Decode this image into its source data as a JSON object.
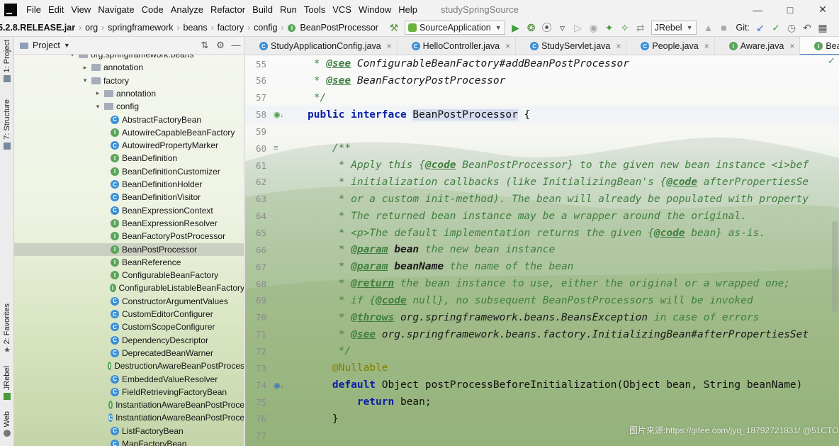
{
  "menu": {
    "items": [
      "File",
      "Edit",
      "View",
      "Navigate",
      "Code",
      "Analyze",
      "Refactor",
      "Build",
      "Run",
      "Tools",
      "VCS",
      "Window",
      "Help"
    ],
    "window_title": "studySpringSource"
  },
  "navbar": {
    "breadcrumbs": [
      "5.2.8.RELEASE.jar",
      "org",
      "springframework",
      "beans",
      "factory",
      "config",
      "BeanPostProcessor"
    ],
    "run_config": "SourceApplication",
    "jrebel": "JRebel",
    "git_label": "Git:"
  },
  "left_stripe": {
    "tabs": [
      "1: Project",
      "7: Structure",
      "2: Favorites",
      "JRebel",
      "Web"
    ]
  },
  "project": {
    "title": "Project",
    "tree": [
      {
        "label": "org.springframework.beans",
        "icon": "package",
        "indent": 0,
        "arrow": "down"
      },
      {
        "label": "annotation",
        "icon": "package",
        "indent": 1,
        "arrow": "right"
      },
      {
        "label": "factory",
        "icon": "package",
        "indent": 1,
        "arrow": "down"
      },
      {
        "label": "annotation",
        "icon": "package",
        "indent": 2,
        "arrow": "right"
      },
      {
        "label": "config",
        "icon": "package",
        "indent": 2,
        "arrow": "down"
      },
      {
        "label": "AbstractFactoryBean",
        "icon": "class",
        "indent": 3
      },
      {
        "label": "AutowireCapableBeanFactory",
        "icon": "interface",
        "indent": 3
      },
      {
        "label": "AutowiredPropertyMarker",
        "icon": "class",
        "indent": 3
      },
      {
        "label": "BeanDefinition",
        "icon": "interface",
        "indent": 3
      },
      {
        "label": "BeanDefinitionCustomizer",
        "icon": "interface",
        "indent": 3
      },
      {
        "label": "BeanDefinitionHolder",
        "icon": "class",
        "indent": 3
      },
      {
        "label": "BeanDefinitionVisitor",
        "icon": "class",
        "indent": 3
      },
      {
        "label": "BeanExpressionContext",
        "icon": "class",
        "indent": 3
      },
      {
        "label": "BeanExpressionResolver",
        "icon": "interface",
        "indent": 3
      },
      {
        "label": "BeanFactoryPostProcessor",
        "icon": "interface",
        "indent": 3
      },
      {
        "label": "BeanPostProcessor",
        "icon": "interface",
        "indent": 3,
        "selected": true
      },
      {
        "label": "BeanReference",
        "icon": "interface",
        "indent": 3
      },
      {
        "label": "ConfigurableBeanFactory",
        "icon": "interface",
        "indent": 3
      },
      {
        "label": "ConfigurableListableBeanFactory",
        "icon": "interface",
        "indent": 3
      },
      {
        "label": "ConstructorArgumentValues",
        "icon": "class",
        "indent": 3
      },
      {
        "label": "CustomEditorConfigurer",
        "icon": "class",
        "indent": 3
      },
      {
        "label": "CustomScopeConfigurer",
        "icon": "class",
        "indent": 3
      },
      {
        "label": "DependencyDescriptor",
        "icon": "class",
        "indent": 3
      },
      {
        "label": "DeprecatedBeanWarner",
        "icon": "class",
        "indent": 3
      },
      {
        "label": "DestructionAwareBeanPostProces",
        "icon": "interface",
        "indent": 3
      },
      {
        "label": "EmbeddedValueResolver",
        "icon": "class",
        "indent": 3
      },
      {
        "label": "FieldRetrievingFactoryBean",
        "icon": "class",
        "indent": 3
      },
      {
        "label": "InstantiationAwareBeanPostProce",
        "icon": "interface",
        "indent": 3
      },
      {
        "label": "InstantiationAwareBeanPostProce",
        "icon": "class",
        "indent": 3
      },
      {
        "label": "ListFactoryBean",
        "icon": "class",
        "indent": 3
      },
      {
        "label": "MapFactoryBean",
        "icon": "class",
        "indent": 3
      }
    ]
  },
  "tabs": [
    {
      "label": "StudyApplicationConfig.java",
      "icon": "class"
    },
    {
      "label": "HelloController.java",
      "icon": "class"
    },
    {
      "label": "StudyServlet.java",
      "icon": "class"
    },
    {
      "label": "People.java",
      "icon": "class"
    },
    {
      "label": "Aware.java",
      "icon": "interface"
    },
    {
      "label": "BeanPostProcessor.java",
      "icon": "interface",
      "active": true
    }
  ],
  "editor": {
    "lines": [
      {
        "no": "55",
        "html": "<span class=\"doc\"> * <span class=\"tag\">@see</span> </span><span style=\"font-style:italic;color:#1a1a1a\">ConfigurableBeanFactory#addBeanPostProcessor</span>"
      },
      {
        "no": "56",
        "html": "<span class=\"doc\"> * <span class=\"tag\">@see</span> </span><span style=\"font-style:italic;color:#1a1a1a\">BeanFactoryPostProcessor</span>"
      },
      {
        "no": "57",
        "html": "<span class=\"doc\"> */</span>"
      },
      {
        "no": "58",
        "gutter": "impl",
        "highlight": true,
        "html": "<span class=\"kw\">public interface</span> <span class=\"ident-hl\">BeanPostProcessor</span> {"
      },
      {
        "no": "59",
        "html": ""
      },
      {
        "no": "60",
        "gutter": "doc",
        "html": "    <span class=\"doc\">/**</span>"
      },
      {
        "no": "61",
        "html": "<span class=\"doc\">     * Apply this {<span class=\"tag\">@code</span> BeanPostProcessor} to the given new bean instance &lt;i&gt;bef</span>"
      },
      {
        "no": "62",
        "html": "<span class=\"doc\">     * initialization callbacks (like InitializingBean's {<span class=\"tag\">@code</span> afterPropertiesSe</span>"
      },
      {
        "no": "63",
        "html": "<span class=\"doc\">     * or a custom init-method). The bean will already be populated with property</span>"
      },
      {
        "no": "64",
        "html": "<span class=\"doc\">     * The returned bean instance may be a wrapper around the original.</span>"
      },
      {
        "no": "65",
        "html": "<span class=\"doc\">     * &lt;p&gt;The default implementation returns the given {<span class=\"tag\">@code</span> bean} as-is.</span>"
      },
      {
        "no": "66",
        "html": "<span class=\"doc\">     * <span class=\"tag\">@param</span> <span style=\"color:#1a1a1a;font-weight:bold\">bean</span> the new bean instance</span>"
      },
      {
        "no": "67",
        "html": "<span class=\"doc\">     * <span class=\"tag\">@param</span> <span style=\"color:#1a1a1a;font-weight:bold\">beanName</span> the name of the bean</span>"
      },
      {
        "no": "68",
        "html": "<span class=\"doc\">     * <span class=\"tag\">@return</span> the bean instance to use, either the original or a wrapped one;</span>"
      },
      {
        "no": "69",
        "html": "<span class=\"doc\">     * if {<span class=\"tag\">@code</span> null}, no subsequent BeanPostProcessors will be invoked</span>"
      },
      {
        "no": "70",
        "html": "<span class=\"doc\">     * <span class=\"tag\">@throws</span> <span style=\"color:#1a1a1a\">org.springframework.beans.BeansException</span> in case of errors</span>"
      },
      {
        "no": "71",
        "html": "<span class=\"doc\">     * <span class=\"tag\">@see</span> <span style=\"color:#1a1a1a\">org.springframework.beans.factory.InitializingBean#afterPropertiesSet</span></span>"
      },
      {
        "no": "72",
        "html": "<span class=\"doc\">     */</span>"
      },
      {
        "no": "73",
        "html": "    <span class=\"ann\">@Nullable</span>"
      },
      {
        "no": "74",
        "gutter": "override",
        "html": "    <span class=\"kw\">default</span> Object postProcessBeforeInitialization(Object bean, String beanName)"
      },
      {
        "no": "75",
        "html": "        <span class=\"kw\">return</span> bean;"
      },
      {
        "no": "76",
        "html": "    }"
      },
      {
        "no": "77",
        "html": ""
      }
    ]
  },
  "watermark": "图片来源:https://gitee.com/jyq_18792721831/ @51CTO博客",
  "colors": {
    "keyword": "#0b1fa6",
    "doc_comment": "#3f7f3f",
    "annotation": "#808000",
    "active_tab_underline": "#4083c9",
    "class_icon": "#3a8fd6",
    "interface_icon": "#5aa55a"
  }
}
